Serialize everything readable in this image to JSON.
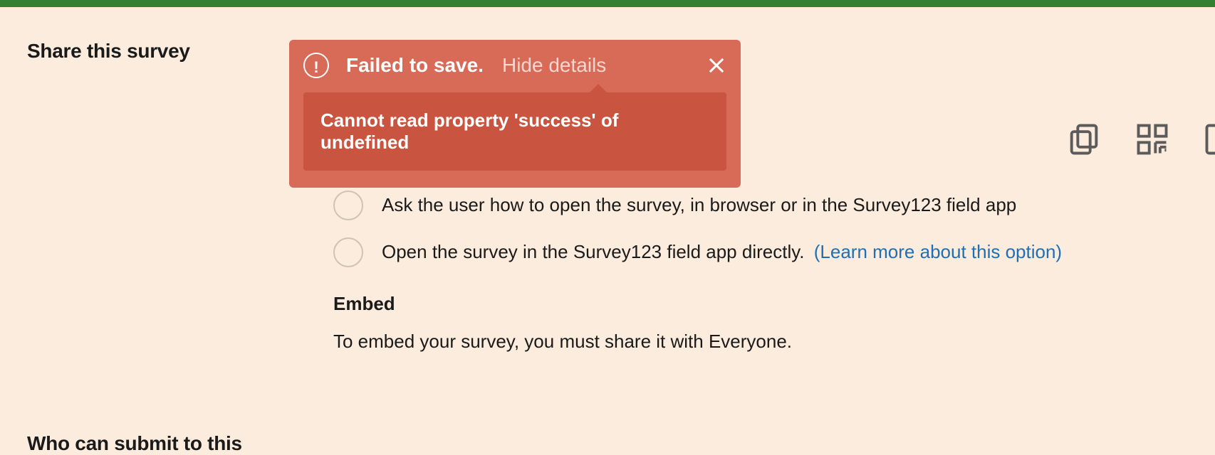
{
  "colors": {
    "bg": "#fbecdd",
    "top_bar": "#338033",
    "toast_bg": "#d86a58",
    "toast_detail_bg": "#c9543f",
    "link": "#1f6fb5"
  },
  "sections": {
    "share_title": "Share this survey",
    "submit_title": "Who can submit to this"
  },
  "toast": {
    "alert_glyph": "!",
    "title": "Failed to save.",
    "toggle_label": "Hide details",
    "detail": "Cannot read property 'success' of undefined"
  },
  "toolbar": {
    "copy": "copy-icon",
    "qr": "qr-code-icon",
    "open": "open-new-window-icon"
  },
  "options": [
    {
      "label": "Ask the user how to open the survey, in browser or in the Survey123 field app"
    },
    {
      "label": "Open the survey in the Survey123 field app directly.",
      "link_text": "(Learn more about this option)"
    }
  ],
  "embed": {
    "heading": "Embed",
    "text": "To embed your survey, you must share it with Everyone."
  }
}
